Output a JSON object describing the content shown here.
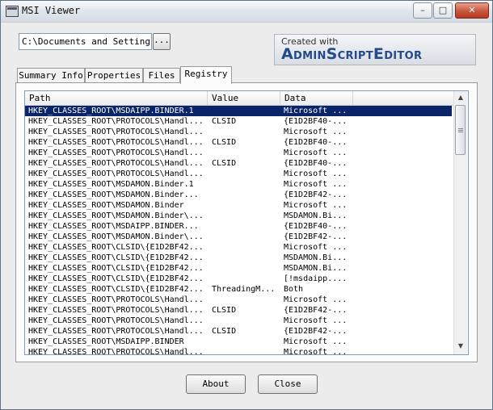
{
  "window": {
    "title": "MSI Viewer"
  },
  "titlebar": {
    "minimize": "–",
    "maximize": "□",
    "close": "✕"
  },
  "file_path": {
    "value": "C:\\Documents and Settings\\",
    "browse_label": "..."
  },
  "logo": {
    "line1": "Created with",
    "line2": "AdminScriptEditor"
  },
  "tabs": [
    "Summary Info",
    "Properties",
    "Files",
    "Registry"
  ],
  "active_tab": "Registry",
  "table": {
    "columns": [
      "Path",
      "Value",
      "Data"
    ],
    "rows": [
      {
        "path": "HKEY_CLASSES_ROOT\\MSDAIPP.BINDER.1",
        "value": "",
        "data": "Microsoft ..."
      },
      {
        "path": "HKEY_CLASSES_ROOT\\PROTOCOLS\\Handl...",
        "value": "CLSID",
        "data": "{E1D2BF40-..."
      },
      {
        "path": "HKEY_CLASSES_ROOT\\PROTOCOLS\\Handl...",
        "value": "",
        "data": "Microsoft ..."
      },
      {
        "path": "HKEY_CLASSES_ROOT\\PROTOCOLS\\Handl...",
        "value": "CLSID",
        "data": "{E1D2BF40-..."
      },
      {
        "path": "HKEY_CLASSES_ROOT\\PROTOCOLS\\Handl...",
        "value": "",
        "data": "Microsoft ..."
      },
      {
        "path": "HKEY_CLASSES_ROOT\\PROTOCOLS\\Handl...",
        "value": "CLSID",
        "data": "{E1D2BF40-..."
      },
      {
        "path": "HKEY_CLASSES_ROOT\\PROTOCOLS\\Handl...",
        "value": "",
        "data": "Microsoft ..."
      },
      {
        "path": "HKEY_CLASSES_ROOT\\MSDAMON.Binder.1",
        "value": "",
        "data": "Microsoft ..."
      },
      {
        "path": "HKEY_CLASSES_ROOT\\MSDAMON.Binder...",
        "value": "",
        "data": "{E1D2BF42-..."
      },
      {
        "path": "HKEY_CLASSES_ROOT\\MSDAMON.Binder",
        "value": "",
        "data": "Microsoft ..."
      },
      {
        "path": "HKEY_CLASSES_ROOT\\MSDAMON.Binder\\...",
        "value": "",
        "data": "MSDAMON.Bi..."
      },
      {
        "path": "HKEY_CLASSES_ROOT\\MSDAIPP.BINDER...",
        "value": "",
        "data": "{E1D2BF40-..."
      },
      {
        "path": "HKEY_CLASSES_ROOT\\MSDAMON.Binder\\...",
        "value": "",
        "data": "{E1D2BF42-..."
      },
      {
        "path": "HKEY_CLASSES_ROOT\\CLSID\\{E1D2BF42...",
        "value": "",
        "data": "Microsoft ..."
      },
      {
        "path": "HKEY_CLASSES_ROOT\\CLSID\\{E1D2BF42...",
        "value": "",
        "data": "MSDAMON.Bi..."
      },
      {
        "path": "HKEY_CLASSES_ROOT\\CLSID\\{E1D2BF42...",
        "value": "",
        "data": "MSDAMON.Bi..."
      },
      {
        "path": "HKEY_CLASSES_ROOT\\CLSID\\{E1D2BF42...",
        "value": "",
        "data": "[!msdaipp...."
      },
      {
        "path": "HKEY_CLASSES_ROOT\\CLSID\\{E1D2BF42...",
        "value": "ThreadingM...",
        "data": "Both"
      },
      {
        "path": "HKEY_CLASSES_ROOT\\PROTOCOLS\\Handl...",
        "value": "",
        "data": "Microsoft ..."
      },
      {
        "path": "HKEY_CLASSES_ROOT\\PROTOCOLS\\Handl...",
        "value": "CLSID",
        "data": "{E1D2BF42-..."
      },
      {
        "path": "HKEY_CLASSES_ROOT\\PROTOCOLS\\Handl...",
        "value": "",
        "data": "Microsoft ..."
      },
      {
        "path": "HKEY_CLASSES_ROOT\\PROTOCOLS\\Handl...",
        "value": "CLSID",
        "data": "{E1D2BF42-..."
      },
      {
        "path": "HKEY_CLASSES_ROOT\\MSDAIPP.BINDER",
        "value": "",
        "data": "Microsoft ..."
      },
      {
        "path": "HKEY_CLASSES_ROOT\\PROTOCOLS\\Handl...",
        "value": "",
        "data": "Microsoft ..."
      }
    ],
    "selected_row": 0
  },
  "scrollbar": {
    "up": "▲",
    "down": "▼"
  },
  "buttons": {
    "about": "About",
    "close": "Close"
  },
  "colors": {
    "selection": "#0a246a",
    "logo_text": "#234a8a"
  }
}
